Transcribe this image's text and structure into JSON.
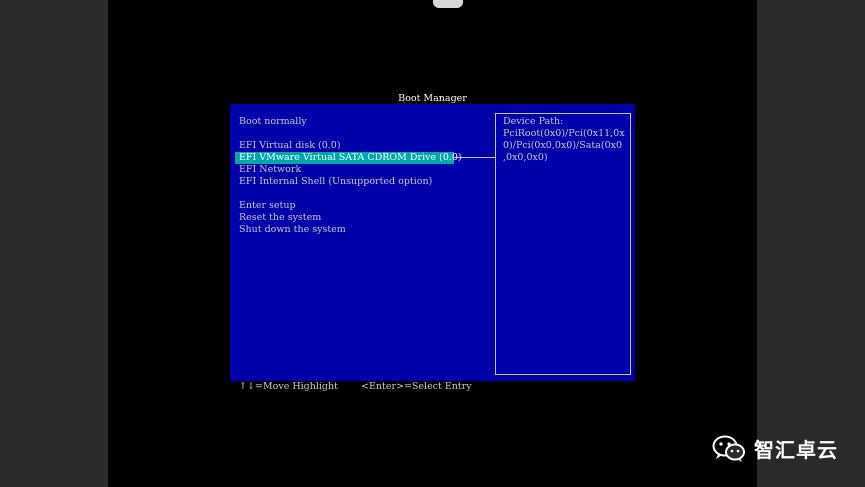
{
  "boot_manager": {
    "title": "Boot Manager",
    "menu_items": [
      {
        "label": "Boot normally",
        "selected": false,
        "gap_before": false
      },
      {
        "label": "EFI Virtual disk (0.0)",
        "selected": false,
        "gap_before": true
      },
      {
        "label": "EFI VMware Virtual SATA CDROM Drive (0.0)",
        "selected": true,
        "gap_before": false
      },
      {
        "label": "EFI Network",
        "selected": false,
        "gap_before": false
      },
      {
        "label": "EFI Internal Shell (Unsupported option)",
        "selected": false,
        "gap_before": false
      },
      {
        "label": "Enter setup",
        "selected": false,
        "gap_before": true
      },
      {
        "label": "Reset the system",
        "selected": false,
        "gap_before": false
      },
      {
        "label": "Shut down the system",
        "selected": false,
        "gap_before": false
      }
    ],
    "help": {
      "lines": [
        "Device Path:",
        "PciRoot(0x0)/Pci(0x11,0x",
        "0)/Pci(0x0,0x0)/Sata(0x0",
        ",0x0,0x0)"
      ]
    },
    "footer": {
      "move_hint": "↑↓=Move Highlight",
      "select_hint": "<Enter>=Select Entry"
    }
  },
  "watermark": {
    "icon": "wechat-icon",
    "text": "智汇卓云"
  },
  "colors": {
    "panel_bg": "#0000aa",
    "highlight_bg": "#00a8a8",
    "text": "#c8c8c8",
    "title_text": "#ffffff"
  }
}
